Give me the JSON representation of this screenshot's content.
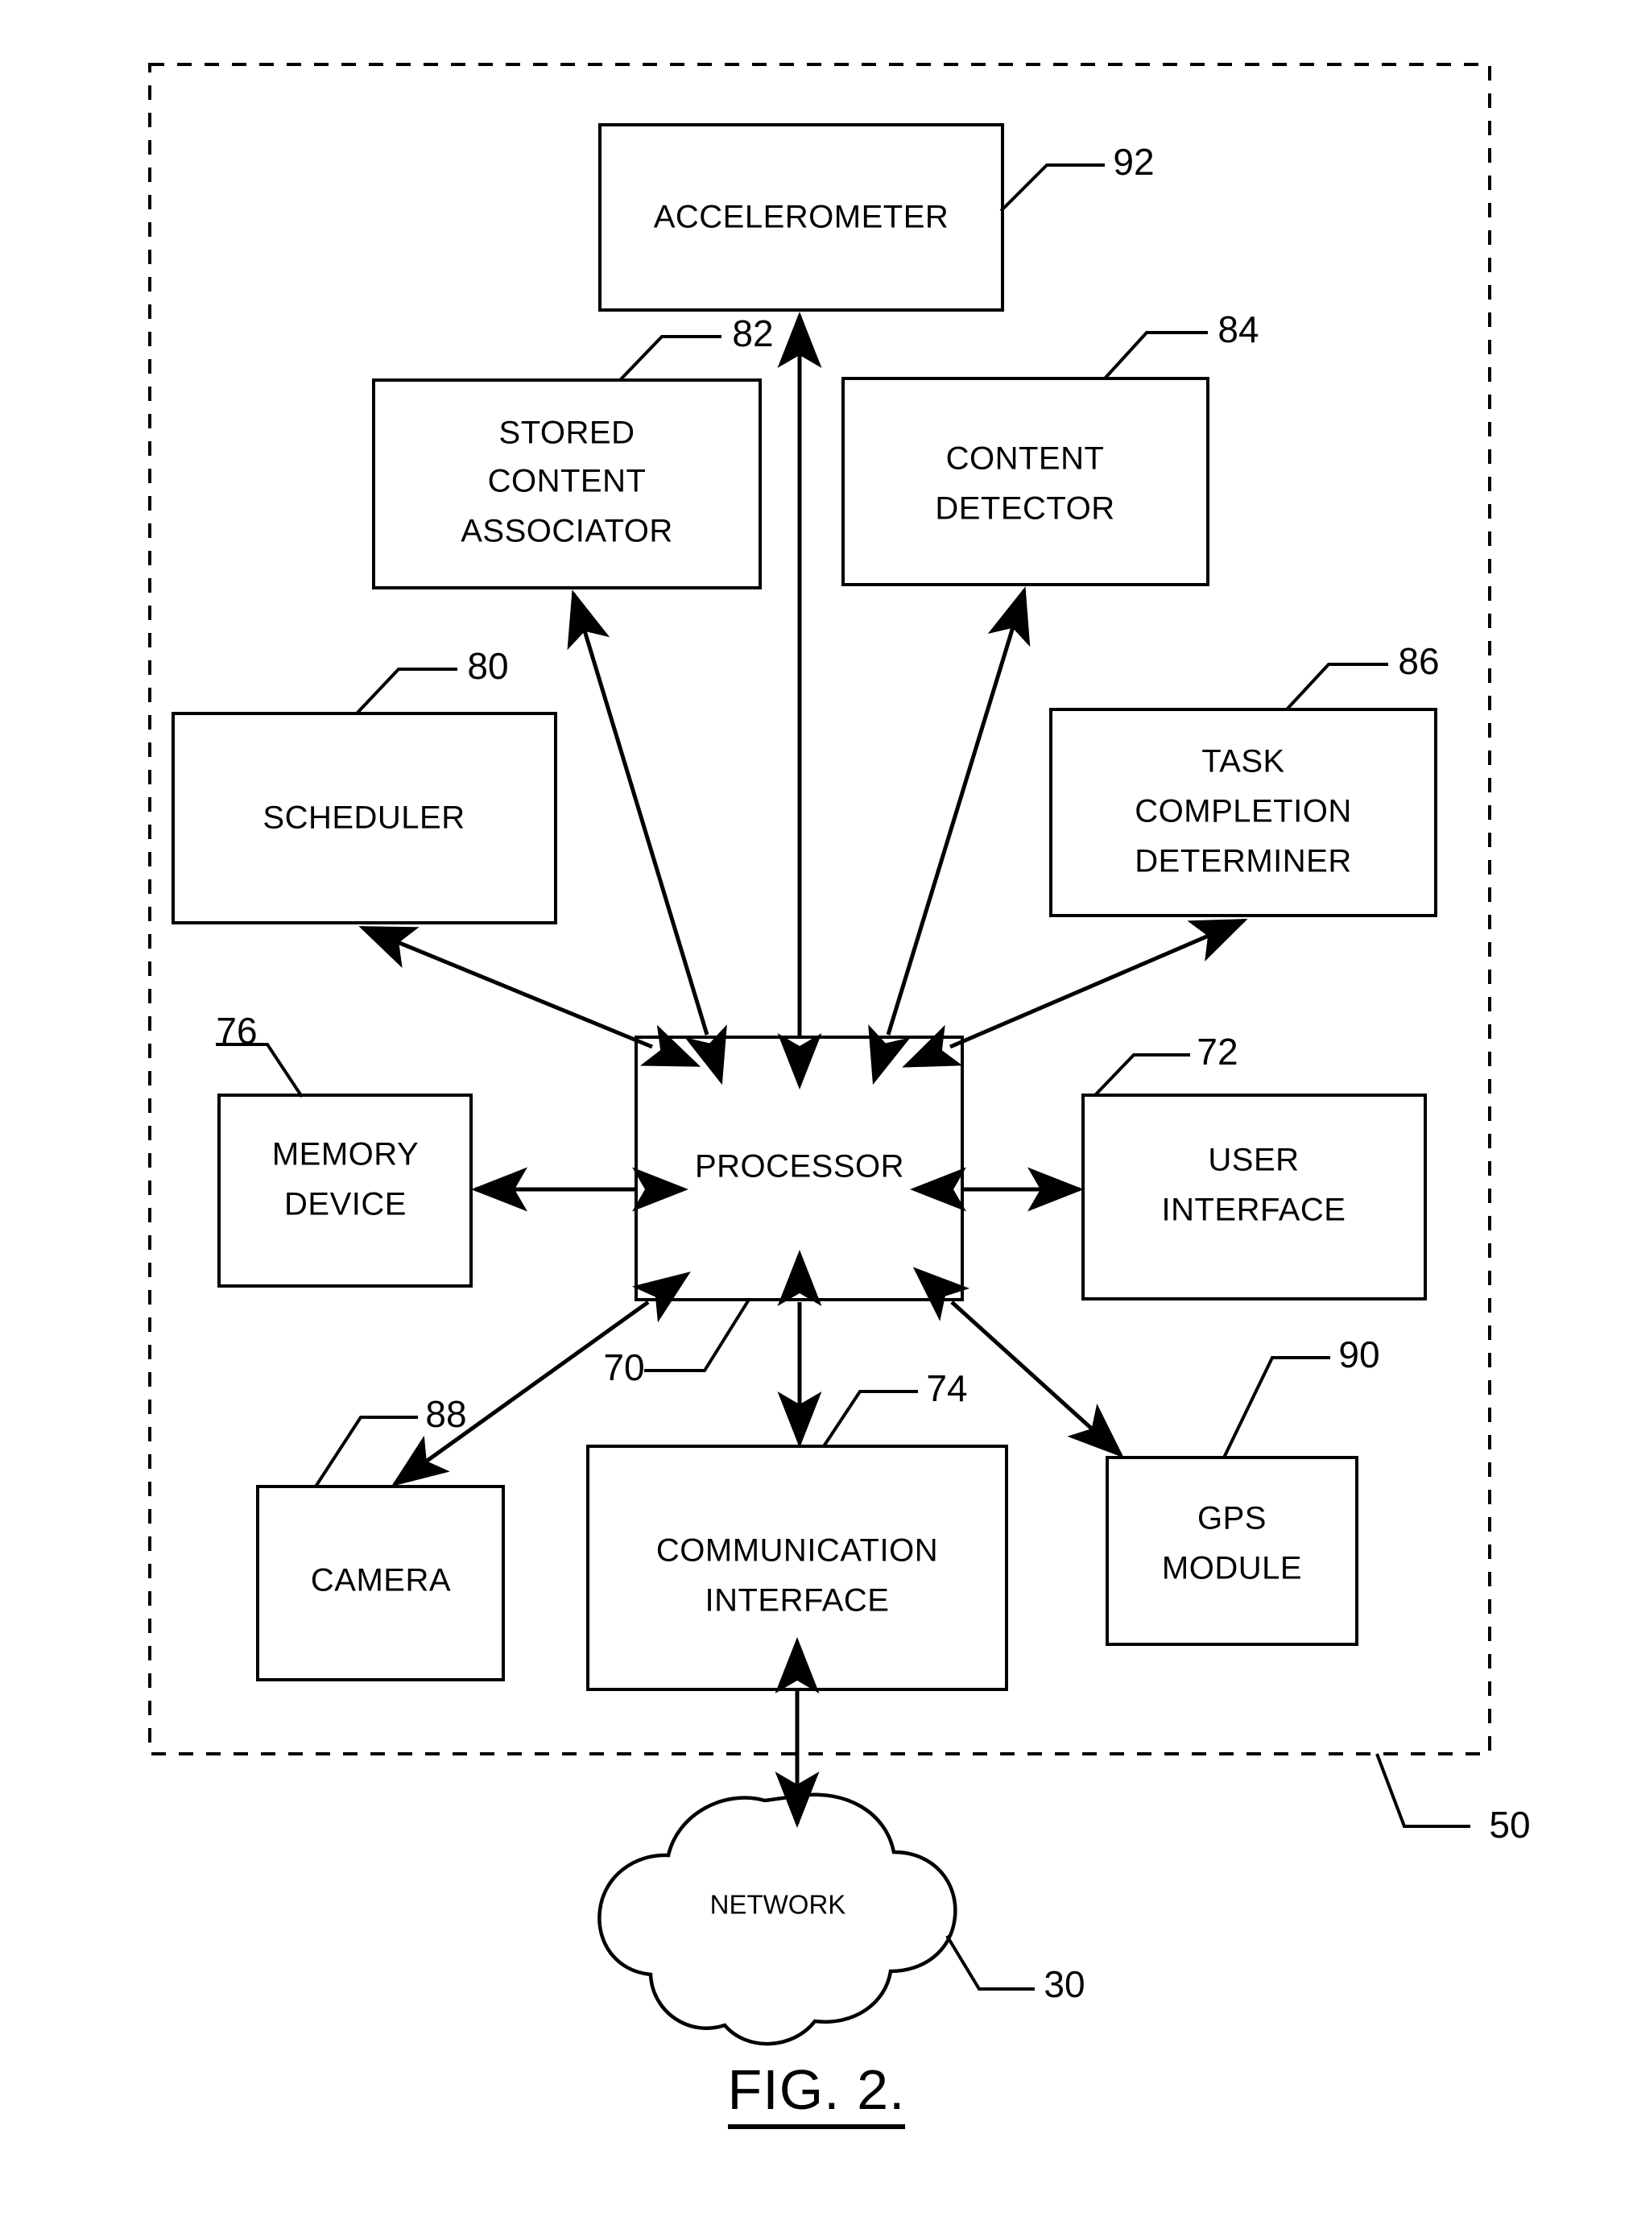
{
  "figure": {
    "caption": "FIG. 2.",
    "enclosure_ref": "50"
  },
  "blocks": [
    {
      "id": "accelerometer",
      "label_lines": [
        "ACCELEROMETER"
      ],
      "ref": "92"
    },
    {
      "id": "stored-content-associator",
      "label_lines": [
        "STORED",
        "CONTENT",
        "ASSOCIATOR"
      ],
      "ref": "82"
    },
    {
      "id": "content-detector",
      "label_lines": [
        "CONTENT",
        "DETECTOR"
      ],
      "ref": "84"
    },
    {
      "id": "scheduler",
      "label_lines": [
        "SCHEDULER"
      ],
      "ref": "80"
    },
    {
      "id": "task-completion-determiner",
      "label_lines": [
        "TASK",
        "COMPLETION",
        "DETERMINER"
      ],
      "ref": "86"
    },
    {
      "id": "memory-device",
      "label_lines": [
        "MEMORY",
        "DEVICE"
      ],
      "ref": "76"
    },
    {
      "id": "processor",
      "label_lines": [
        "PROCESSOR"
      ],
      "ref": "70"
    },
    {
      "id": "user-interface",
      "label_lines": [
        "USER",
        "INTERFACE"
      ],
      "ref": "72"
    },
    {
      "id": "camera",
      "label_lines": [
        "CAMERA"
      ],
      "ref": "88"
    },
    {
      "id": "communication-interface",
      "label_lines": [
        "COMMUNICATION",
        "INTERFACE"
      ],
      "ref": "74"
    },
    {
      "id": "gps-module",
      "label_lines": [
        "GPS",
        "MODULE"
      ],
      "ref": "90"
    },
    {
      "id": "network",
      "label_lines": [
        "NETWORK"
      ],
      "ref": "30"
    }
  ],
  "labels": {
    "accelerometer": "ACCELEROMETER",
    "stored_1": "STORED",
    "stored_2": "CONTENT",
    "stored_3": "ASSOCIATOR",
    "content_detector_1": "CONTENT",
    "content_detector_2": "DETECTOR",
    "scheduler": "SCHEDULER",
    "task_1": "TASK",
    "task_2": "COMPLETION",
    "task_3": "DETERMINER",
    "memory_1": "MEMORY",
    "memory_2": "DEVICE",
    "processor": "PROCESSOR",
    "ui_1": "USER",
    "ui_2": "INTERFACE",
    "camera": "CAMERA",
    "comm_1": "COMMUNICATION",
    "comm_2": "INTERFACE",
    "gps_1": "GPS",
    "gps_2": "MODULE",
    "network": "NETWORK"
  },
  "refs": {
    "accelerometer": "92",
    "stored_content_associator": "82",
    "content_detector": "84",
    "scheduler": "80",
    "task_completion_determiner": "86",
    "memory_device": "76",
    "processor": "70",
    "user_interface": "72",
    "camera": "88",
    "communication_interface": "74",
    "gps_module": "90",
    "network": "30",
    "apparatus": "50"
  },
  "connections": [
    {
      "from": "processor",
      "to": "accelerometer",
      "type": "bidirectional"
    },
    {
      "from": "processor",
      "to": "stored-content-associator",
      "type": "bidirectional"
    },
    {
      "from": "processor",
      "to": "content-detector",
      "type": "bidirectional"
    },
    {
      "from": "processor",
      "to": "scheduler",
      "type": "bidirectional"
    },
    {
      "from": "processor",
      "to": "task-completion-determiner",
      "type": "bidirectional"
    },
    {
      "from": "processor",
      "to": "memory-device",
      "type": "bidirectional"
    },
    {
      "from": "processor",
      "to": "user-interface",
      "type": "bidirectional"
    },
    {
      "from": "processor",
      "to": "camera",
      "type": "bidirectional"
    },
    {
      "from": "processor",
      "to": "communication-interface",
      "type": "bidirectional"
    },
    {
      "from": "processor",
      "to": "gps-module",
      "type": "bidirectional"
    },
    {
      "from": "communication-interface",
      "to": "network",
      "type": "bidirectional"
    }
  ],
  "colors": {
    "stroke": "#000000",
    "background": "#ffffff"
  }
}
